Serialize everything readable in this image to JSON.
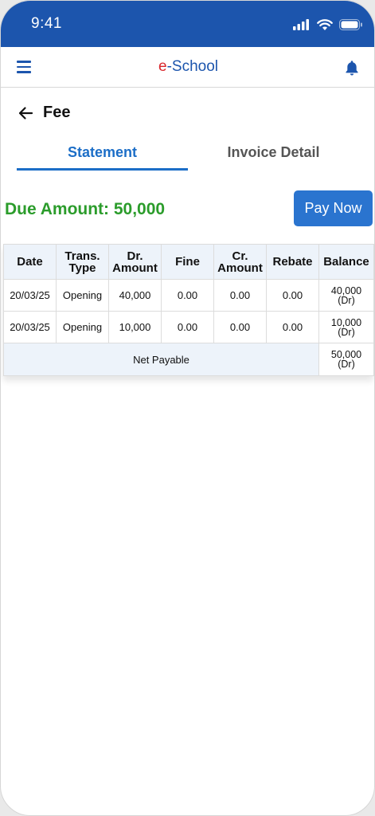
{
  "status_bar": {
    "time": "9:41"
  },
  "header": {
    "brand_prefix": "e",
    "brand_suffix": "-School"
  },
  "page": {
    "title": "Fee"
  },
  "tabs": [
    {
      "label": "Statement",
      "active": true
    },
    {
      "label": "Invoice Detail",
      "active": false
    }
  ],
  "due": {
    "label": "Due Amount: 50,000"
  },
  "pay_button": {
    "label": "Pay Now"
  },
  "colors": {
    "primary": "#1c55ad",
    "accent_blue": "#2a74cf",
    "due_green": "#2b9c2b",
    "brand_red": "#d9262c",
    "table_header_bg": "#edf3fa"
  },
  "icons": [
    "hamburger-menu-icon",
    "bell-icon",
    "back-arrow-icon",
    "signal-icon",
    "wifi-icon",
    "battery-icon"
  ],
  "table": {
    "headers": [
      [
        "Date"
      ],
      [
        "Trans.",
        "Type"
      ],
      [
        "Dr.",
        "Amount"
      ],
      [
        "Fine"
      ],
      [
        "Cr.",
        "Amount"
      ],
      [
        "Rebate"
      ],
      [
        "Balance"
      ]
    ],
    "rows": [
      {
        "date": "20/03/25",
        "type": "Opening",
        "dr": "40,000",
        "fine": "0.00",
        "cr": "0.00",
        "rebate": "0.00",
        "balance": "40,000",
        "balance_note": "(Dr)"
      },
      {
        "date": "20/03/25",
        "type": "Opening",
        "dr": "10,000",
        "fine": "0.00",
        "cr": "0.00",
        "rebate": "0.00",
        "balance": "10,000",
        "balance_note": "(Dr)"
      }
    ],
    "net": {
      "label": "Net Payable",
      "balance": "50,000",
      "balance_note": "(Dr)"
    }
  }
}
